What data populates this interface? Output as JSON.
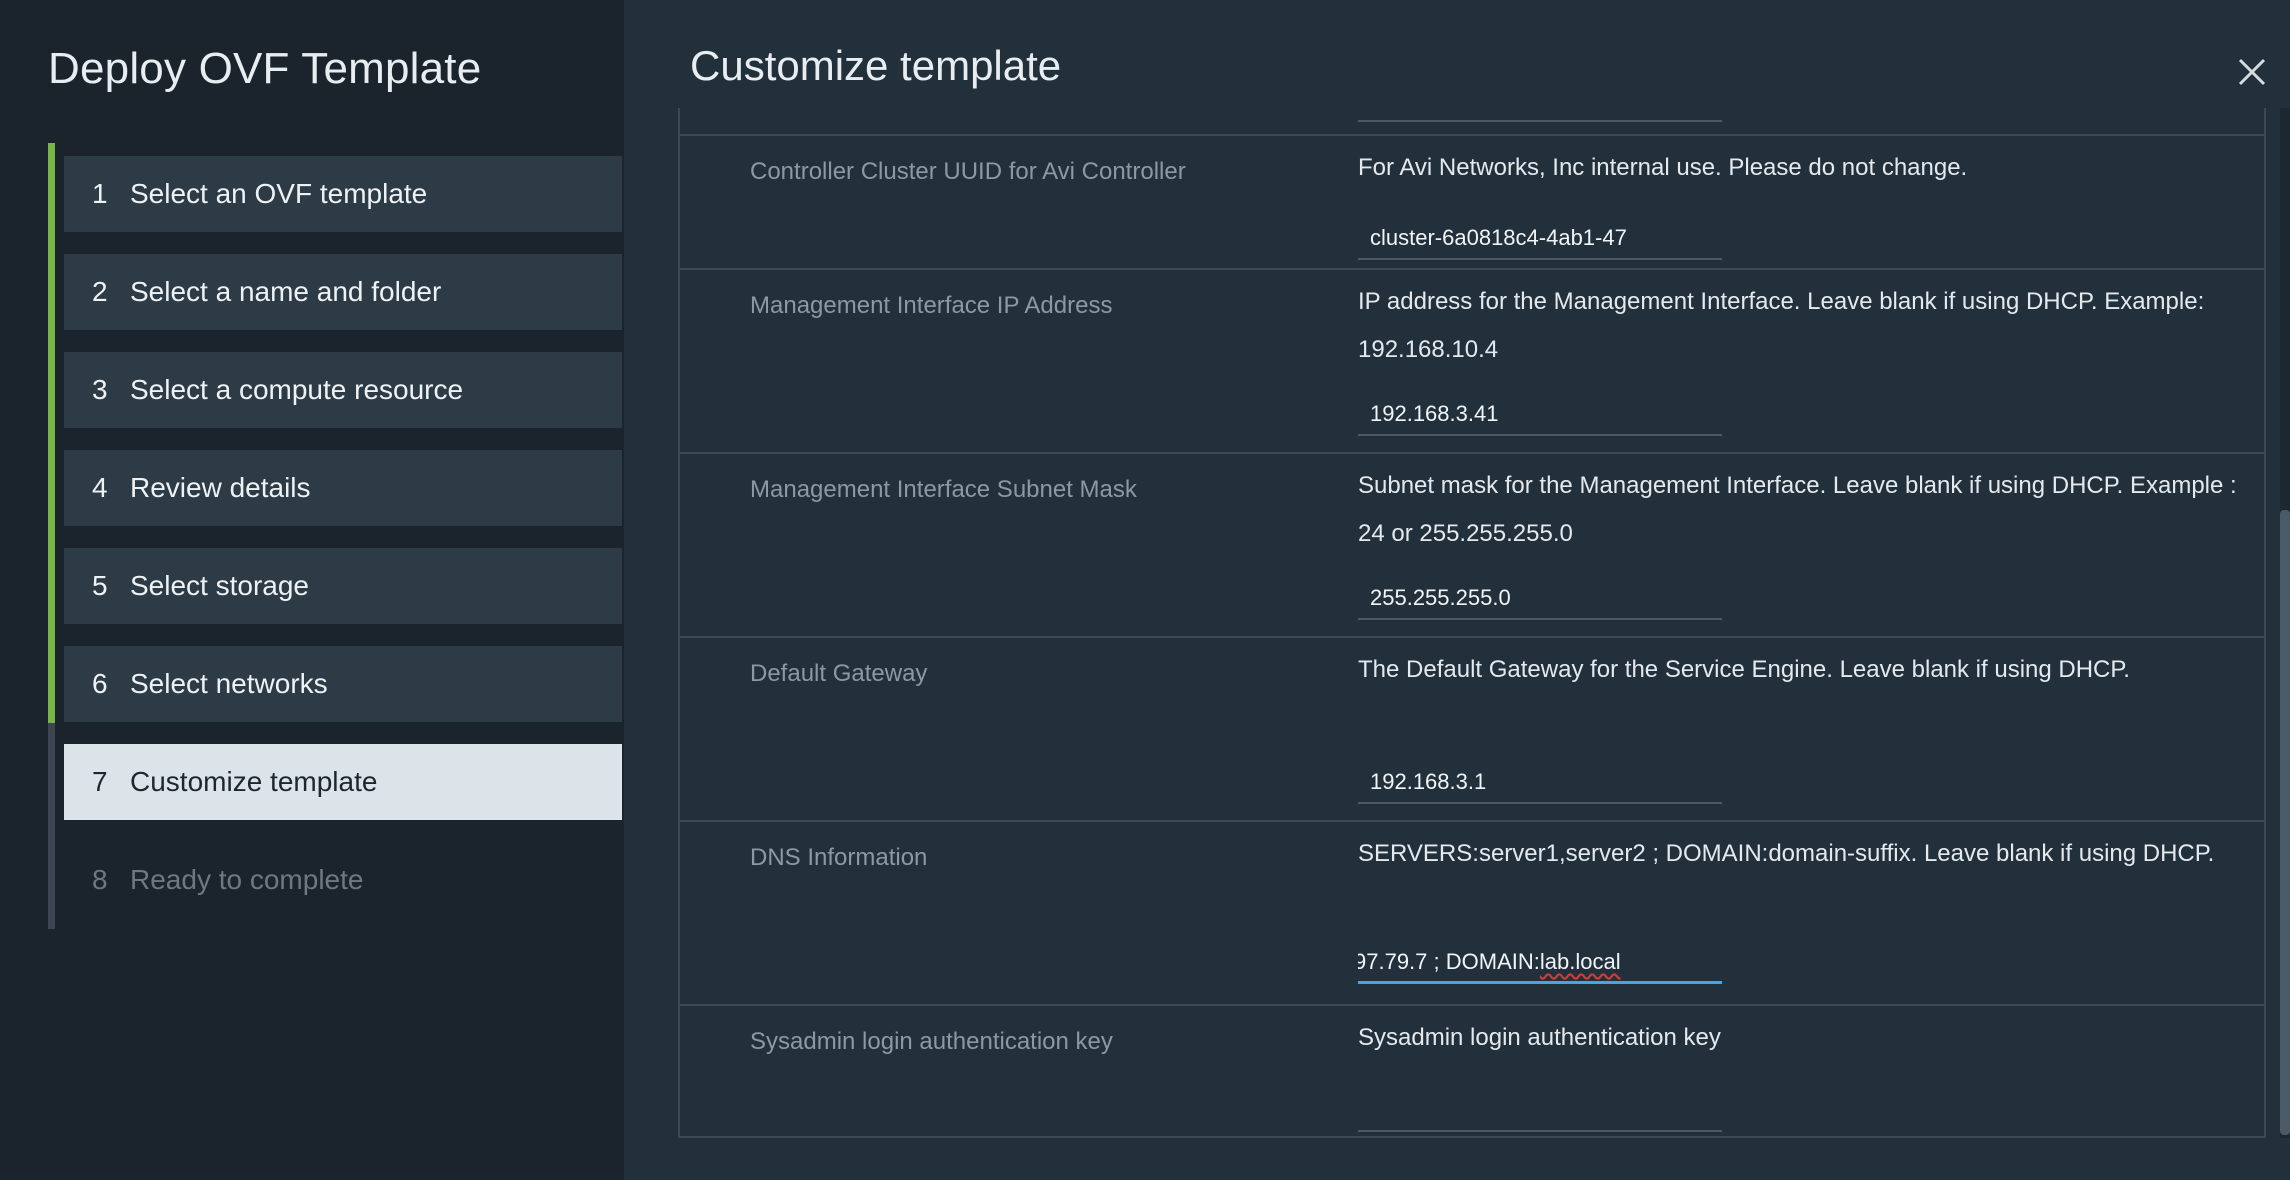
{
  "wizard": {
    "title": "Deploy OVF Template",
    "steps": [
      {
        "num": "1",
        "label": "Select an OVF template"
      },
      {
        "num": "2",
        "label": "Select a name and folder"
      },
      {
        "num": "3",
        "label": "Select a compute resource"
      },
      {
        "num": "4",
        "label": "Review details"
      },
      {
        "num": "5",
        "label": "Select storage"
      },
      {
        "num": "6",
        "label": "Select networks"
      },
      {
        "num": "7",
        "label": "Customize template"
      },
      {
        "num": "8",
        "label": "Ready to complete"
      }
    ],
    "active_step": "7"
  },
  "main": {
    "title": "Customize template",
    "close_icon": "close-icon",
    "properties": [
      {
        "label": "Controller Cluster UUID for Avi Controller",
        "description": "For Avi Networks, Inc internal use. Please do not change.",
        "value": "cluster-6a0818c4-4ab1-47"
      },
      {
        "label": "Management Interface IP Address",
        "description": "IP address for the Management Interface. Leave blank if using DHCP. Example: 192.168.10.4",
        "value": "192.168.3.41"
      },
      {
        "label": "Management Interface Subnet Mask",
        "description": "Subnet mask for the Management Interface. Leave blank if using DHCP. Example : 24 or 255.255.255.0",
        "value": "255.255.255.0"
      },
      {
        "label": "Default Gateway",
        "description": "The Default Gateway for the Service Engine. Leave blank if using DHCP.",
        "value": "192.168.3.1"
      },
      {
        "label": "DNS Information",
        "description": "SERVERS:server1,server2 ; DOMAIN:domain-suffix. Leave blank if using DHCP.",
        "value_prefix": "97.79.7 ; DOMAIN:",
        "value_suffix": "lab.local"
      },
      {
        "label": "Sysadmin login authentication key",
        "description": "Sysadmin login authentication key",
        "value": ""
      }
    ]
  },
  "colors": {
    "accent_green": "#7ab547",
    "focus_blue": "#49a3e6",
    "active_step_bg": "#dce4ea"
  }
}
